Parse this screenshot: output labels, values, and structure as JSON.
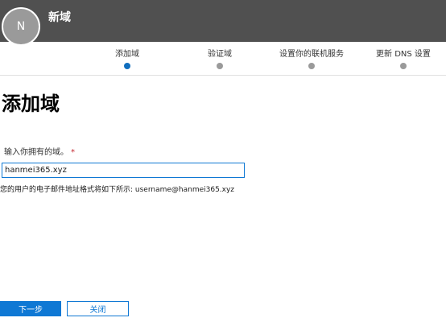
{
  "header": {
    "avatar_initial": "N",
    "title": "新域"
  },
  "steps": [
    {
      "label": "添加域",
      "state": "active"
    },
    {
      "label": "验证域",
      "state": "pending"
    },
    {
      "label": "设置你的联机服务",
      "state": "pending"
    },
    {
      "label": "更新 DNS 设置",
      "state": "pending"
    }
  ],
  "main": {
    "title": "添加域",
    "field_label": "输入你拥有的域。",
    "required_marker": "*",
    "domain_value": "hanmei365.xyz",
    "hint": "您的用户的电子邮件地址格式将如下所示: username@hanmei365.xyz"
  },
  "footer": {
    "next_label": "下一步",
    "close_label": "关闭"
  },
  "colors": {
    "header_bg": "#505050",
    "accent": "#0f78d4",
    "active_step": "#106ebe",
    "inactive_step": "#9a9a9a",
    "required": "#c4262e"
  }
}
